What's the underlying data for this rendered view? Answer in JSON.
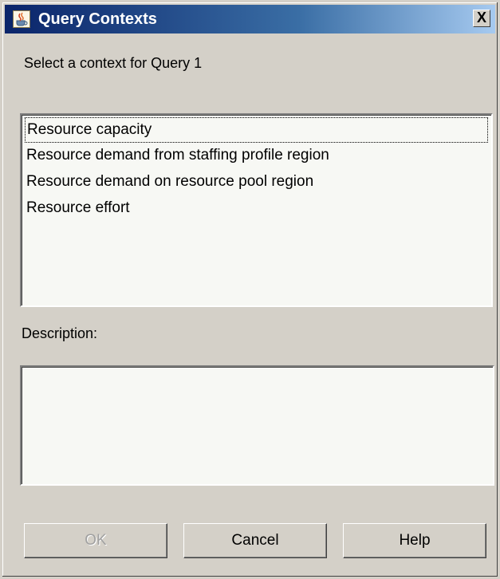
{
  "window": {
    "title": "Query Contexts",
    "app_icon": "java-coffee-cup-icon",
    "close_label": "X"
  },
  "prompt": "Select a context for Query 1",
  "contexts": {
    "items": [
      "Resource capacity",
      "Resource demand from staffing profile region",
      "Resource demand on resource pool region",
      "Resource effort"
    ],
    "focused": "Resource capacity"
  },
  "description": {
    "label": "Description:",
    "value": ""
  },
  "buttons": {
    "ok": "OK",
    "cancel": "Cancel",
    "help": "Help",
    "ok_enabled": false
  },
  "colors": {
    "title_bar_start": "#0a246a",
    "title_bar_end": "#a6caf0",
    "dialog_face": "#d4d0c8",
    "field_bg": "#f7f8f4"
  }
}
